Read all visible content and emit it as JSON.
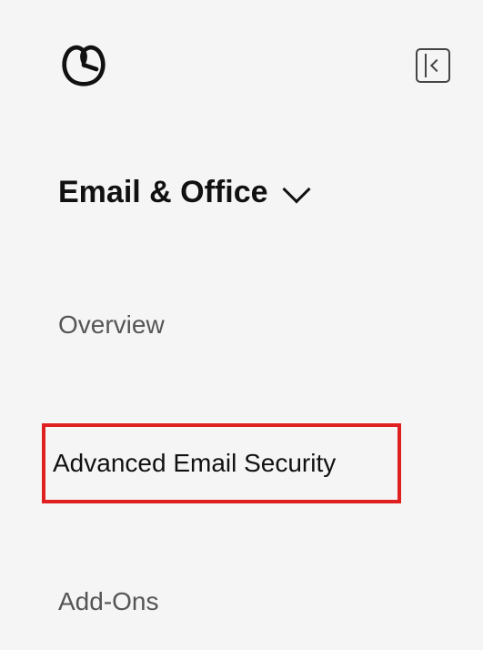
{
  "section": {
    "title": "Email & Office"
  },
  "nav": {
    "items": [
      {
        "label": "Overview"
      },
      {
        "label": "Advanced Email Security"
      },
      {
        "label": "Add-Ons"
      }
    ]
  }
}
